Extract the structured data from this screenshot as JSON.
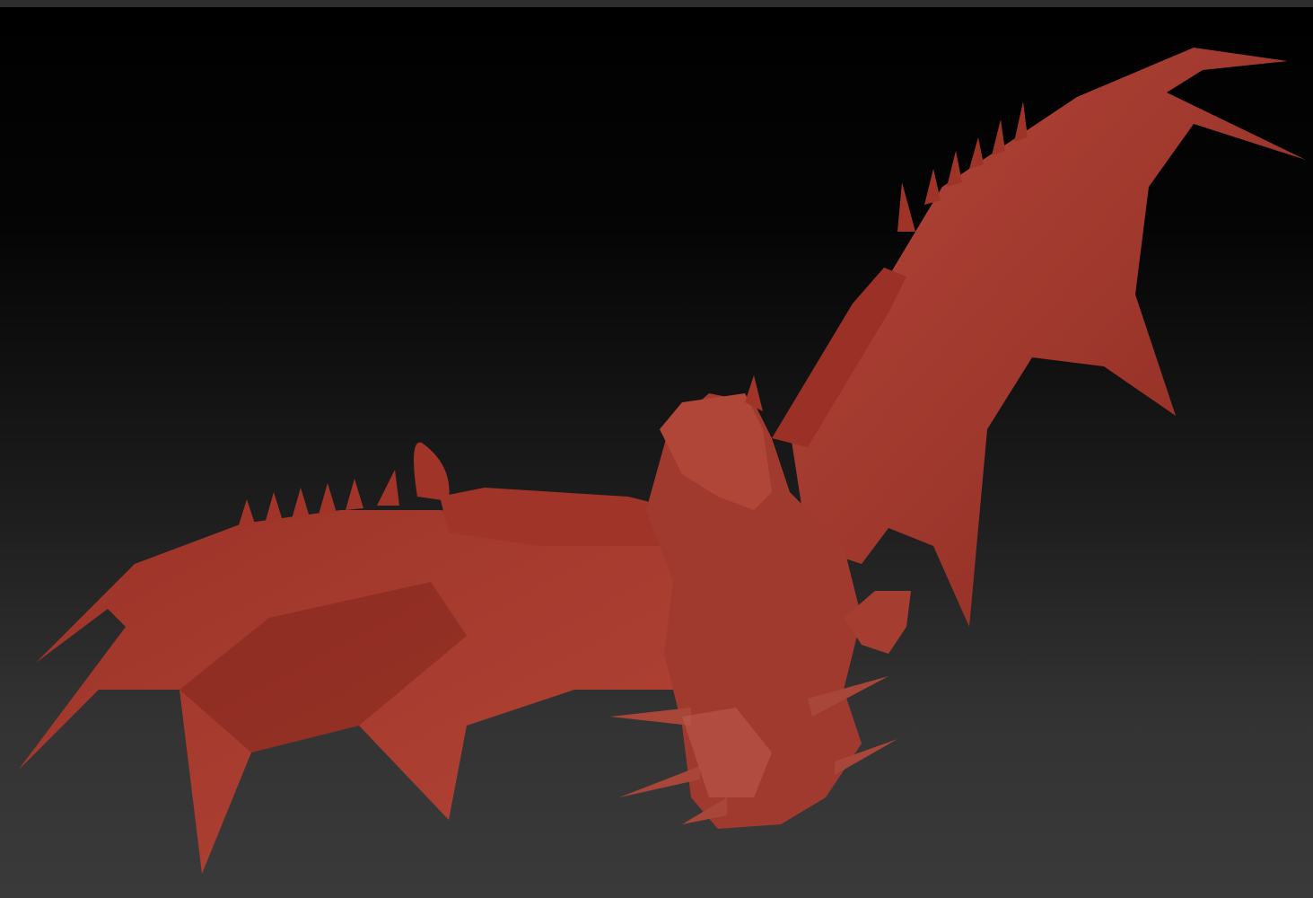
{
  "scene": {
    "subject": "dragon-sculpt",
    "colors": {
      "model": "#a8382c",
      "model_shadow": "#6e1d16",
      "model_highlight": "#c85a4a",
      "background_top": "#000000",
      "background_bottom": "#3a3a3a"
    }
  }
}
